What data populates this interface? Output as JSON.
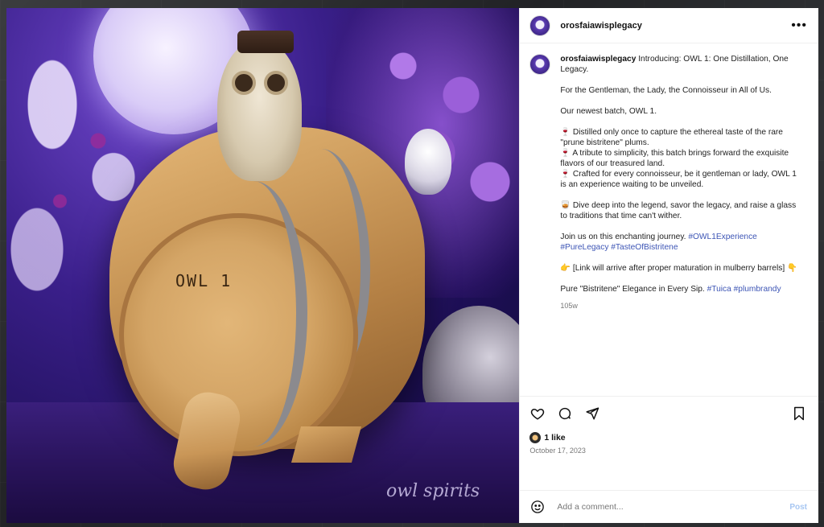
{
  "post": {
    "image_watermark": "owl spirits",
    "barrel_label": "OWL 1"
  },
  "header": {
    "username": "orosfaiawisplegacy",
    "more_icon": "•••"
  },
  "caption": {
    "username": "orosfaiawisplegacy",
    "intro": "Introducing: OWL 1: One Distillation, One Legacy.",
    "p2": "For the Gentleman, the Lady, the Connoisseur in All of Us.",
    "p3": "Our newest batch, OWL 1.",
    "bullet1": "🍷 Distilled only once to capture the ethereal taste of the rare \"prune bistritene\" plums.",
    "bullet2": "🍷 A tribute to simplicity, this batch brings forward the exquisite flavors of our treasured land.",
    "bullet3": "🍷 Crafted for every connoisseur, be it gentleman or lady, OWL 1 is an experience waiting to be unveiled.",
    "p5": "🥃 Dive deep into the legend, savor the legacy, and raise a glass to traditions that time can't wither.",
    "p6_text": "Join us on this enchanting journey. ",
    "p6_tag1": "#OWL1Experience",
    "p6_tag2": "#PureLegacy",
    "p6_tag3": "#TasteOfBistritene",
    "p7": "👉 [Link will arrive after proper maturation in mulberry barrels] 👇",
    "p8_text": "Pure \"Bistritene\" Elegance in Every Sip. ",
    "p8_tag1": "#Tuica",
    "p8_tag2": "#plumbrandy",
    "time_ago": "105w"
  },
  "actions": {
    "like_icon": "heart-icon",
    "comment_icon": "comment-icon",
    "share_icon": "send-icon",
    "save_icon": "bookmark-icon",
    "likes_count": "1 like",
    "date": "October 17, 2023"
  },
  "add_comment": {
    "placeholder": "Add a comment...",
    "post_label": "Post",
    "emoji_icon": "emoji-icon"
  }
}
